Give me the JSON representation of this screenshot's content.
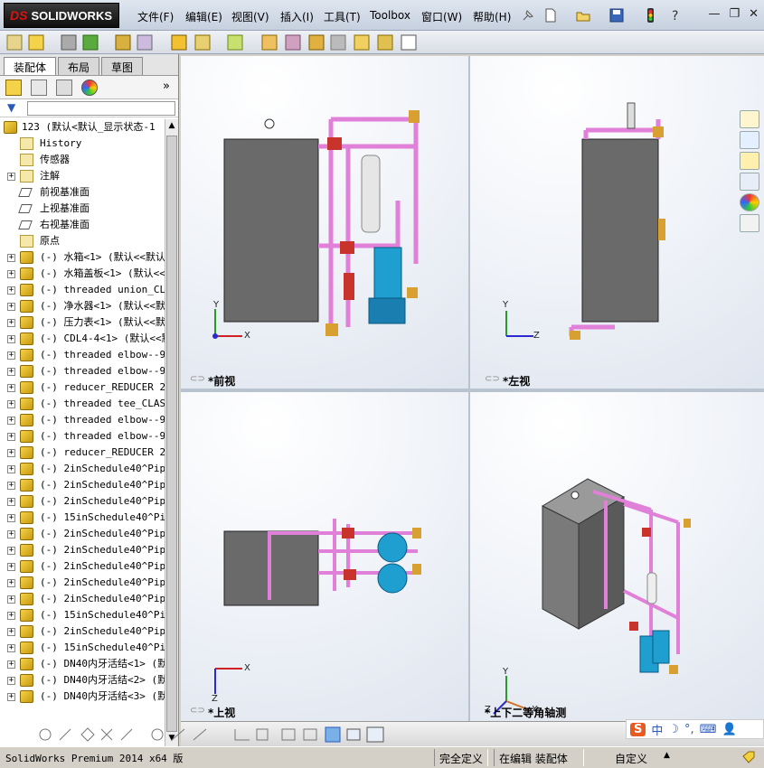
{
  "app": {
    "brand_prefix": "DS",
    "brand": "SOLIDWORKS"
  },
  "menu": [
    "文件(F)",
    "编辑(E)",
    "视图(V)",
    "插入(I)",
    "工具(T)",
    "Toolbox",
    "窗口(W)",
    "帮助(H)"
  ],
  "panel_tabs": [
    "装配体",
    "布局",
    "草图"
  ],
  "tree": {
    "root": "123  (默认<默认_显示状态-1",
    "items": [
      {
        "label": "History",
        "expand": "",
        "icon": "history-icon"
      },
      {
        "label": "传感器",
        "expand": "",
        "icon": "sensor-icon"
      },
      {
        "label": "注解",
        "expand": "+",
        "icon": "annotation-icon"
      },
      {
        "label": "前视基准面",
        "expand": "",
        "icon": "plane-icon"
      },
      {
        "label": "上视基准面",
        "expand": "",
        "icon": "plane-icon"
      },
      {
        "label": "右视基准面",
        "expand": "",
        "icon": "plane-icon"
      },
      {
        "label": "原点",
        "expand": "",
        "icon": "origin-icon"
      },
      {
        "label": "(-) 水箱<1> (默认<<默认",
        "expand": "+",
        "icon": "part-icon"
      },
      {
        "label": "(-) 水箱盖板<1> (默认<<",
        "expand": "+",
        "icon": "part-icon"
      },
      {
        "label": "(-) threaded union_CLAS",
        "expand": "+",
        "icon": "part-icon"
      },
      {
        "label": "(-) 净水器<1> (默认<<默",
        "expand": "+",
        "icon": "part-icon"
      },
      {
        "label": "(-) 压力表<1> (默认<<默",
        "expand": "+",
        "icon": "part-icon"
      },
      {
        "label": "(-) CDL4-4<1> (默认<<默",
        "expand": "+",
        "icon": "part-icon"
      },
      {
        "label": "(-) threaded elbow--90d",
        "expand": "+",
        "icon": "part-icon"
      },
      {
        "label": "(-) threaded elbow--90d",
        "expand": "+",
        "icon": "part-icon"
      },
      {
        "label": "(-) reducer_REDUCER 2 x",
        "expand": "+",
        "icon": "part-icon"
      },
      {
        "label": "(-) threaded tee_CLASS",
        "expand": "+",
        "icon": "part-icon"
      },
      {
        "label": "(-) threaded elbow--90d",
        "expand": "+",
        "icon": "part-icon"
      },
      {
        "label": "(-) threaded elbow--90d",
        "expand": "+",
        "icon": "part-icon"
      },
      {
        "label": "(-) reducer_REDUCER 2 x",
        "expand": "+",
        "icon": "part-icon"
      },
      {
        "label": "(-) 2inSchedule40^Pipe_",
        "expand": "+",
        "icon": "part-icon"
      },
      {
        "label": "(-) 2inSchedule40^Pipe_",
        "expand": "+",
        "icon": "part-icon"
      },
      {
        "label": "(-) 2inSchedule40^Pipe_",
        "expand": "+",
        "icon": "part-icon"
      },
      {
        "label": "(-) 15inSchedule40^Pipe",
        "expand": "+",
        "icon": "part-icon"
      },
      {
        "label": "(-) 2inSchedule40^Pipe_",
        "expand": "+",
        "icon": "part-icon"
      },
      {
        "label": "(-) 2inSchedule40^Pipe_",
        "expand": "+",
        "icon": "part-icon"
      },
      {
        "label": "(-) 2inSchedule40^Pipe_",
        "expand": "+",
        "icon": "part-icon"
      },
      {
        "label": "(-) 2inSchedule40^Pipe_",
        "expand": "+",
        "icon": "part-icon"
      },
      {
        "label": "(-) 2inSchedule40^Pipe_",
        "expand": "+",
        "icon": "part-icon"
      },
      {
        "label": "(-) 15inSchedule40^Pipe",
        "expand": "+",
        "icon": "part-icon"
      },
      {
        "label": "(-) 2inSchedule40^Pipe_",
        "expand": "+",
        "icon": "part-icon"
      },
      {
        "label": "(-) 15inSchedule40^Pipe",
        "expand": "+",
        "icon": "part-icon"
      },
      {
        "label": "(-) DN40内牙活结<1> (默",
        "expand": "+",
        "icon": "part-icon"
      },
      {
        "label": "(-) DN40内牙活结<2> (默",
        "expand": "+",
        "icon": "part-icon"
      },
      {
        "label": "(-) DN40内牙活结<3> (默",
        "expand": "+",
        "icon": "part-icon"
      }
    ]
  },
  "views": {
    "front": "*前视",
    "left": "*左视",
    "top": "*上视",
    "iso": "*上下二等角轴测"
  },
  "axes": {
    "x": "X",
    "y": "Y",
    "z": "Z"
  },
  "status": {
    "version": "SolidWorks Premium 2014 x64 版",
    "defined": "完全定义",
    "editing": "在编辑 装配体",
    "custom": "自定义"
  },
  "ime": {
    "label": "中"
  },
  "colors": {
    "pipe": "#e080d8",
    "tank": "#6a6a6a",
    "pump": "#1e9fd0",
    "fitting": "#c8342c",
    "brass": "#d8a030"
  }
}
